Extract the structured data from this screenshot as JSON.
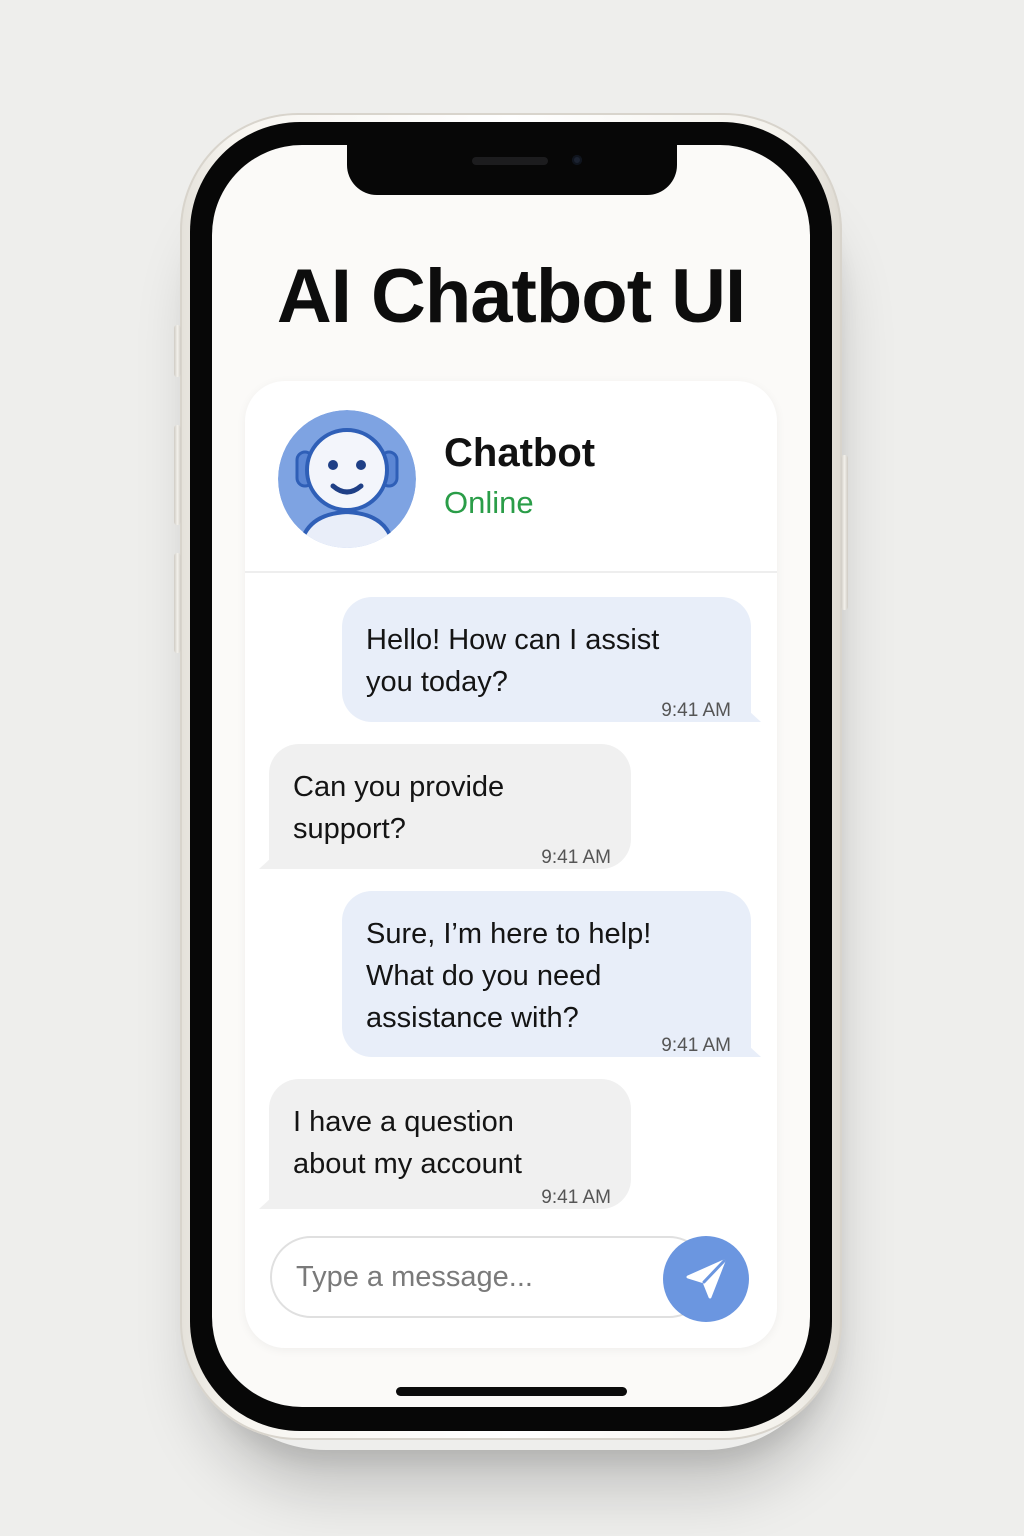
{
  "app": {
    "title": "AI Chatbot UI"
  },
  "chat": {
    "bot_name": "Chatbot",
    "status": "Online",
    "status_color": "#2a9d48",
    "avatar_icon": "smiling-robot-face-with-headset"
  },
  "messages": [
    {
      "sender": "bot",
      "text": "Hello! How can I assist\nyou today?",
      "time": "9:41 AM"
    },
    {
      "sender": "user",
      "text": "Can you provide\nsupport?",
      "time": "9:41 AM"
    },
    {
      "sender": "bot",
      "text": "Sure, I’m here to help!\nWhat do you need\nassistance with?",
      "time": "9:41 AM"
    },
    {
      "sender": "user",
      "text": "I have a question\nabout my account",
      "time": "9:41 AM"
    }
  ],
  "composer": {
    "placeholder": "Type a message...",
    "value": "",
    "send_icon": "paper-plane-icon",
    "accent_color": "#6b96e0"
  },
  "colors": {
    "bot_bubble": "#e8eef9",
    "user_bubble": "#f0f0f0"
  }
}
